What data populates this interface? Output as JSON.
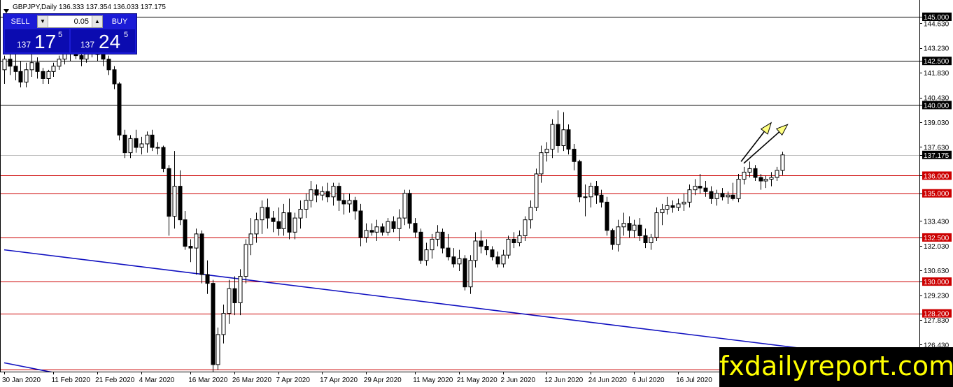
{
  "header": {
    "symbol_line": "GBPJPY,Daily  136.333 137.354 136.033 137.175"
  },
  "trade_panel": {
    "sell_label": "SELL",
    "buy_label": "BUY",
    "lot_value": "0.05",
    "sell_quote": {
      "small": "137",
      "big": "17",
      "sup": "5"
    },
    "buy_quote": {
      "small": "137",
      "big": "24",
      "sup": "5"
    }
  },
  "watermark": "fxdailyreport.com",
  "colors": {
    "background": "#ffffff",
    "bull_body": "#ffffff",
    "bear_body": "#000000",
    "resistance_line": "#cc0000",
    "round_line": "#000000",
    "trend_line": "#1010c0",
    "arrow_fill": "#ffff80",
    "panel_blue": "#1b1bd6",
    "watermark_text": "#ffff00"
  },
  "chart_data": {
    "type": "candlestick",
    "symbol": "GBPJPY",
    "timeframe": "Daily",
    "ylim": [
      124.9,
      145.95
    ],
    "y_ticks": [
      "145.000",
      "144.630",
      "143.230",
      "142.500",
      "141.830",
      "140.430",
      "140.000",
      "139.030",
      "137.630",
      "137.175",
      "136.000",
      "135.000",
      "133.430",
      "132.500",
      "132.030",
      "130.630",
      "130.000",
      "129.230",
      "128.200",
      "127.830",
      "126.430",
      "125.000"
    ],
    "highlighted_ticks": {
      "black": [
        "145.000",
        "142.500",
        "140.000",
        "137.175"
      ],
      "red": [
        "136.000",
        "135.000",
        "132.500",
        "130.000",
        "128.200",
        "125.000"
      ]
    },
    "x_labels": [
      "30 Jan 2020",
      "11 Feb 2020",
      "21 Feb 2020",
      "4 Mar 2020",
      "16 Mar 2020",
      "26 Mar 2020",
      "7 Apr 2020",
      "17 Apr 2020",
      "29 Apr 2020",
      "11 May 2020",
      "21 May 2020",
      "2 Jun 2020",
      "12 Jun 2020",
      "24 Jun 2020",
      "6 Jul 2020",
      "16 Jul 2020"
    ],
    "x_label_bars": [
      0,
      9,
      17,
      25,
      34,
      42,
      50,
      58,
      66,
      75,
      83,
      91,
      99,
      107,
      115,
      123
    ],
    "horizontal_levels": {
      "black": [
        145.0,
        142.5,
        140.0
      ],
      "red": [
        136.0,
        135.0,
        132.5,
        130.0,
        128.2,
        125.0
      ]
    },
    "current_price_line": 137.175,
    "trend_lines": [
      {
        "from": {
          "bar": 0,
          "price": 131.8
        },
        "to": {
          "bar": 169.5,
          "price": 125.3
        }
      },
      {
        "from": {
          "bar": 0,
          "price": 125.4
        },
        "to": {
          "bar": 29.5,
          "price": 123.6
        }
      }
    ],
    "arrows": [
      {
        "from": {
          "bar": 134.5,
          "price": 136.8
        },
        "to": {
          "bar": 140,
          "price": 139.0
        }
      },
      {
        "from": {
          "bar": 135,
          "price": 136.7
        },
        "to": {
          "bar": 143,
          "price": 138.9
        }
      }
    ],
    "candles": [
      {
        "o": 142.0,
        "h": 142.8,
        "l": 141.2,
        "c": 142.6
      },
      {
        "o": 142.6,
        "h": 143.1,
        "l": 141.7,
        "c": 142.2
      },
      {
        "o": 142.2,
        "h": 142.9,
        "l": 141.4,
        "c": 141.9
      },
      {
        "o": 141.9,
        "h": 142.5,
        "l": 141.0,
        "c": 141.3
      },
      {
        "o": 141.3,
        "h": 142.4,
        "l": 141.0,
        "c": 142.0
      },
      {
        "o": 142.0,
        "h": 142.9,
        "l": 141.6,
        "c": 142.4
      },
      {
        "o": 142.4,
        "h": 142.7,
        "l": 141.5,
        "c": 141.9
      },
      {
        "o": 141.9,
        "h": 142.1,
        "l": 141.2,
        "c": 141.5
      },
      {
        "o": 141.5,
        "h": 142.0,
        "l": 141.2,
        "c": 141.9
      },
      {
        "o": 141.9,
        "h": 142.4,
        "l": 141.6,
        "c": 142.2
      },
      {
        "o": 142.2,
        "h": 142.8,
        "l": 142.0,
        "c": 142.6
      },
      {
        "o": 142.6,
        "h": 143.2,
        "l": 142.3,
        "c": 142.9
      },
      {
        "o": 142.9,
        "h": 143.4,
        "l": 142.5,
        "c": 143.0
      },
      {
        "o": 143.0,
        "h": 143.3,
        "l": 142.6,
        "c": 142.8
      },
      {
        "o": 142.8,
        "h": 143.1,
        "l": 142.2,
        "c": 142.6
      },
      {
        "o": 142.6,
        "h": 143.4,
        "l": 142.4,
        "c": 143.2
      },
      {
        "o": 143.2,
        "h": 143.6,
        "l": 142.7,
        "c": 142.9
      },
      {
        "o": 142.9,
        "h": 143.2,
        "l": 142.5,
        "c": 142.9
      },
      {
        "o": 142.9,
        "h": 143.2,
        "l": 142.2,
        "c": 142.6
      },
      {
        "o": 142.6,
        "h": 142.8,
        "l": 141.7,
        "c": 142.0
      },
      {
        "o": 142.0,
        "h": 142.2,
        "l": 140.9,
        "c": 141.2
      },
      {
        "o": 141.2,
        "h": 141.3,
        "l": 138.0,
        "c": 138.3
      },
      {
        "o": 138.3,
        "h": 138.6,
        "l": 137.0,
        "c": 137.3
      },
      {
        "o": 137.3,
        "h": 138.3,
        "l": 137.0,
        "c": 138.1
      },
      {
        "o": 138.1,
        "h": 138.6,
        "l": 137.3,
        "c": 137.6
      },
      {
        "o": 137.6,
        "h": 138.2,
        "l": 137.2,
        "c": 137.8
      },
      {
        "o": 137.8,
        "h": 138.5,
        "l": 137.3,
        "c": 138.3
      },
      {
        "o": 138.3,
        "h": 138.6,
        "l": 137.4,
        "c": 137.6
      },
      {
        "o": 137.6,
        "h": 137.9,
        "l": 137.2,
        "c": 137.6
      },
      {
        "o": 137.6,
        "h": 137.7,
        "l": 136.2,
        "c": 136.4
      },
      {
        "o": 136.4,
        "h": 136.6,
        "l": 132.6,
        "c": 133.7
      },
      {
        "o": 133.7,
        "h": 137.4,
        "l": 133.0,
        "c": 135.4
      },
      {
        "o": 135.4,
        "h": 136.3,
        "l": 133.2,
        "c": 133.5
      },
      {
        "o": 133.5,
        "h": 134.0,
        "l": 131.8,
        "c": 132.0
      },
      {
        "o": 132.0,
        "h": 132.4,
        "l": 131.1,
        "c": 131.9
      },
      {
        "o": 131.9,
        "h": 133.0,
        "l": 130.4,
        "c": 132.7
      },
      {
        "o": 132.7,
        "h": 132.9,
        "l": 129.9,
        "c": 130.4
      },
      {
        "o": 130.4,
        "h": 131.2,
        "l": 129.3,
        "c": 129.9
      },
      {
        "o": 129.9,
        "h": 130.1,
        "l": 124.9,
        "c": 125.3
      },
      {
        "o": 125.3,
        "h": 127.4,
        "l": 125.0,
        "c": 127.0
      },
      {
        "o": 127.0,
        "h": 128.7,
        "l": 126.5,
        "c": 128.2
      },
      {
        "o": 128.2,
        "h": 130.1,
        "l": 127.6,
        "c": 129.6
      },
      {
        "o": 129.6,
        "h": 130.3,
        "l": 128.1,
        "c": 128.8
      },
      {
        "o": 128.8,
        "h": 130.7,
        "l": 128.1,
        "c": 130.3
      },
      {
        "o": 130.3,
        "h": 132.4,
        "l": 129.9,
        "c": 132.1
      },
      {
        "o": 132.1,
        "h": 133.6,
        "l": 131.5,
        "c": 132.7
      },
      {
        "o": 132.7,
        "h": 133.9,
        "l": 132.2,
        "c": 133.5
      },
      {
        "o": 133.5,
        "h": 134.6,
        "l": 132.7,
        "c": 134.2
      },
      {
        "o": 134.2,
        "h": 134.7,
        "l": 133.0,
        "c": 133.6
      },
      {
        "o": 133.6,
        "h": 134.0,
        "l": 132.8,
        "c": 133.4
      },
      {
        "o": 133.4,
        "h": 134.2,
        "l": 132.6,
        "c": 133.0
      },
      {
        "o": 133.0,
        "h": 134.4,
        "l": 132.6,
        "c": 133.9
      },
      {
        "o": 133.9,
        "h": 134.7,
        "l": 132.4,
        "c": 132.8
      },
      {
        "o": 132.8,
        "h": 133.9,
        "l": 132.4,
        "c": 133.6
      },
      {
        "o": 133.6,
        "h": 134.6,
        "l": 133.0,
        "c": 134.1
      },
      {
        "o": 134.1,
        "h": 135.0,
        "l": 133.6,
        "c": 134.6
      },
      {
        "o": 134.6,
        "h": 135.7,
        "l": 134.2,
        "c": 135.2
      },
      {
        "o": 135.2,
        "h": 135.5,
        "l": 134.5,
        "c": 134.9
      },
      {
        "o": 134.9,
        "h": 135.4,
        "l": 134.6,
        "c": 135.1
      },
      {
        "o": 135.1,
        "h": 135.6,
        "l": 134.5,
        "c": 134.8
      },
      {
        "o": 134.8,
        "h": 135.6,
        "l": 134.3,
        "c": 135.4
      },
      {
        "o": 135.4,
        "h": 135.6,
        "l": 134.0,
        "c": 134.6
      },
      {
        "o": 134.6,
        "h": 135.0,
        "l": 133.8,
        "c": 134.4
      },
      {
        "o": 134.4,
        "h": 135.0,
        "l": 133.9,
        "c": 134.6
      },
      {
        "o": 134.6,
        "h": 134.8,
        "l": 133.5,
        "c": 134.0
      },
      {
        "o": 134.0,
        "h": 134.4,
        "l": 132.0,
        "c": 132.5
      },
      {
        "o": 132.5,
        "h": 133.3,
        "l": 132.2,
        "c": 132.9
      },
      {
        "o": 132.9,
        "h": 133.3,
        "l": 132.6,
        "c": 132.8
      },
      {
        "o": 132.8,
        "h": 133.5,
        "l": 132.3,
        "c": 133.1
      },
      {
        "o": 133.1,
        "h": 133.3,
        "l": 132.6,
        "c": 132.8
      },
      {
        "o": 132.8,
        "h": 133.6,
        "l": 132.6,
        "c": 133.4
      },
      {
        "o": 133.4,
        "h": 133.7,
        "l": 132.8,
        "c": 133.0
      },
      {
        "o": 133.0,
        "h": 134.1,
        "l": 132.3,
        "c": 133.6
      },
      {
        "o": 133.6,
        "h": 135.2,
        "l": 133.2,
        "c": 135.0
      },
      {
        "o": 135.0,
        "h": 135.2,
        "l": 133.0,
        "c": 133.3
      },
      {
        "o": 133.3,
        "h": 133.6,
        "l": 132.5,
        "c": 132.8
      },
      {
        "o": 132.8,
        "h": 133.0,
        "l": 131.0,
        "c": 131.2
      },
      {
        "o": 131.2,
        "h": 132.2,
        "l": 130.9,
        "c": 131.8
      },
      {
        "o": 131.8,
        "h": 132.7,
        "l": 131.3,
        "c": 132.4
      },
      {
        "o": 132.4,
        "h": 133.2,
        "l": 132.0,
        "c": 132.8
      },
      {
        "o": 132.8,
        "h": 133.0,
        "l": 131.6,
        "c": 131.9
      },
      {
        "o": 131.9,
        "h": 132.7,
        "l": 131.2,
        "c": 131.4
      },
      {
        "o": 131.4,
        "h": 131.9,
        "l": 130.8,
        "c": 131.0
      },
      {
        "o": 131.0,
        "h": 131.8,
        "l": 130.6,
        "c": 131.3
      },
      {
        "o": 131.3,
        "h": 131.5,
        "l": 129.5,
        "c": 129.7
      },
      {
        "o": 129.7,
        "h": 131.5,
        "l": 129.3,
        "c": 131.2
      },
      {
        "o": 131.2,
        "h": 132.8,
        "l": 130.8,
        "c": 132.3
      },
      {
        "o": 132.3,
        "h": 132.9,
        "l": 131.6,
        "c": 132.0
      },
      {
        "o": 132.0,
        "h": 132.4,
        "l": 131.5,
        "c": 131.8
      },
      {
        "o": 131.8,
        "h": 132.0,
        "l": 131.2,
        "c": 131.4
      },
      {
        "o": 131.4,
        "h": 131.7,
        "l": 130.8,
        "c": 131.0
      },
      {
        "o": 131.0,
        "h": 131.8,
        "l": 130.8,
        "c": 131.5
      },
      {
        "o": 131.5,
        "h": 132.6,
        "l": 131.3,
        "c": 132.4
      },
      {
        "o": 132.4,
        "h": 132.8,
        "l": 131.9,
        "c": 132.2
      },
      {
        "o": 132.2,
        "h": 132.9,
        "l": 132.0,
        "c": 132.6
      },
      {
        "o": 132.6,
        "h": 133.7,
        "l": 132.3,
        "c": 133.5
      },
      {
        "o": 133.5,
        "h": 134.6,
        "l": 133.0,
        "c": 134.2
      },
      {
        "o": 134.2,
        "h": 136.4,
        "l": 134.0,
        "c": 136.1
      },
      {
        "o": 136.1,
        "h": 137.7,
        "l": 135.6,
        "c": 137.3
      },
      {
        "o": 137.3,
        "h": 137.9,
        "l": 136.8,
        "c": 137.5
      },
      {
        "o": 137.5,
        "h": 139.2,
        "l": 137.0,
        "c": 138.9
      },
      {
        "o": 138.9,
        "h": 139.7,
        "l": 137.3,
        "c": 137.7
      },
      {
        "o": 137.7,
        "h": 139.6,
        "l": 137.4,
        "c": 138.6
      },
      {
        "o": 138.6,
        "h": 138.9,
        "l": 137.2,
        "c": 137.5
      },
      {
        "o": 137.5,
        "h": 137.8,
        "l": 136.3,
        "c": 136.8
      },
      {
        "o": 136.8,
        "h": 136.9,
        "l": 134.5,
        "c": 134.8
      },
      {
        "o": 134.8,
        "h": 135.5,
        "l": 133.7,
        "c": 134.8
      },
      {
        "o": 134.8,
        "h": 135.6,
        "l": 134.2,
        "c": 135.4
      },
      {
        "o": 135.4,
        "h": 135.7,
        "l": 134.4,
        "c": 134.9
      },
      {
        "o": 134.9,
        "h": 135.2,
        "l": 134.2,
        "c": 134.5
      },
      {
        "o": 134.5,
        "h": 134.8,
        "l": 132.6,
        "c": 132.9
      },
      {
        "o": 132.9,
        "h": 133.0,
        "l": 131.8,
        "c": 132.1
      },
      {
        "o": 132.1,
        "h": 133.5,
        "l": 131.7,
        "c": 133.1
      },
      {
        "o": 133.1,
        "h": 133.9,
        "l": 132.6,
        "c": 133.3
      },
      {
        "o": 133.3,
        "h": 133.7,
        "l": 132.5,
        "c": 132.9
      },
      {
        "o": 132.9,
        "h": 133.5,
        "l": 132.5,
        "c": 133.2
      },
      {
        "o": 133.2,
        "h": 133.6,
        "l": 132.3,
        "c": 132.6
      },
      {
        "o": 132.6,
        "h": 133.0,
        "l": 131.9,
        "c": 132.2
      },
      {
        "o": 132.2,
        "h": 132.7,
        "l": 131.8,
        "c": 132.5
      },
      {
        "o": 132.5,
        "h": 134.2,
        "l": 132.3,
        "c": 133.9
      },
      {
        "o": 133.9,
        "h": 134.4,
        "l": 133.2,
        "c": 134.1
      },
      {
        "o": 134.1,
        "h": 134.8,
        "l": 133.8,
        "c": 134.3
      },
      {
        "o": 134.3,
        "h": 134.6,
        "l": 133.9,
        "c": 134.2
      },
      {
        "o": 134.2,
        "h": 134.7,
        "l": 134.0,
        "c": 134.4
      },
      {
        "o": 134.4,
        "h": 135.0,
        "l": 134.0,
        "c": 134.5
      },
      {
        "o": 134.5,
        "h": 135.5,
        "l": 134.2,
        "c": 135.2
      },
      {
        "o": 135.2,
        "h": 135.8,
        "l": 134.9,
        "c": 135.4
      },
      {
        "o": 135.4,
        "h": 136.1,
        "l": 135.0,
        "c": 135.3
      },
      {
        "o": 135.3,
        "h": 135.7,
        "l": 134.8,
        "c": 135.1
      },
      {
        "o": 135.1,
        "h": 135.4,
        "l": 134.4,
        "c": 134.7
      },
      {
        "o": 134.7,
        "h": 135.2,
        "l": 134.3,
        "c": 135.0
      },
      {
        "o": 135.0,
        "h": 135.3,
        "l": 134.6,
        "c": 134.8
      },
      {
        "o": 134.8,
        "h": 135.1,
        "l": 134.4,
        "c": 134.9
      },
      {
        "o": 134.9,
        "h": 135.6,
        "l": 134.6,
        "c": 134.7
      },
      {
        "o": 134.7,
        "h": 136.1,
        "l": 134.5,
        "c": 135.8
      },
      {
        "o": 135.8,
        "h": 136.5,
        "l": 135.5,
        "c": 136.2
      },
      {
        "o": 136.2,
        "h": 136.8,
        "l": 135.9,
        "c": 136.4
      },
      {
        "o": 136.4,
        "h": 136.6,
        "l": 135.7,
        "c": 135.9
      },
      {
        "o": 135.9,
        "h": 136.1,
        "l": 135.2,
        "c": 135.7
      },
      {
        "o": 135.7,
        "h": 136.0,
        "l": 135.3,
        "c": 135.8
      },
      {
        "o": 135.8,
        "h": 136.2,
        "l": 135.4,
        "c": 135.9
      },
      {
        "o": 135.9,
        "h": 136.5,
        "l": 135.7,
        "c": 136.3
      },
      {
        "o": 136.3,
        "h": 137.354,
        "l": 136.033,
        "c": 137.175
      }
    ]
  }
}
